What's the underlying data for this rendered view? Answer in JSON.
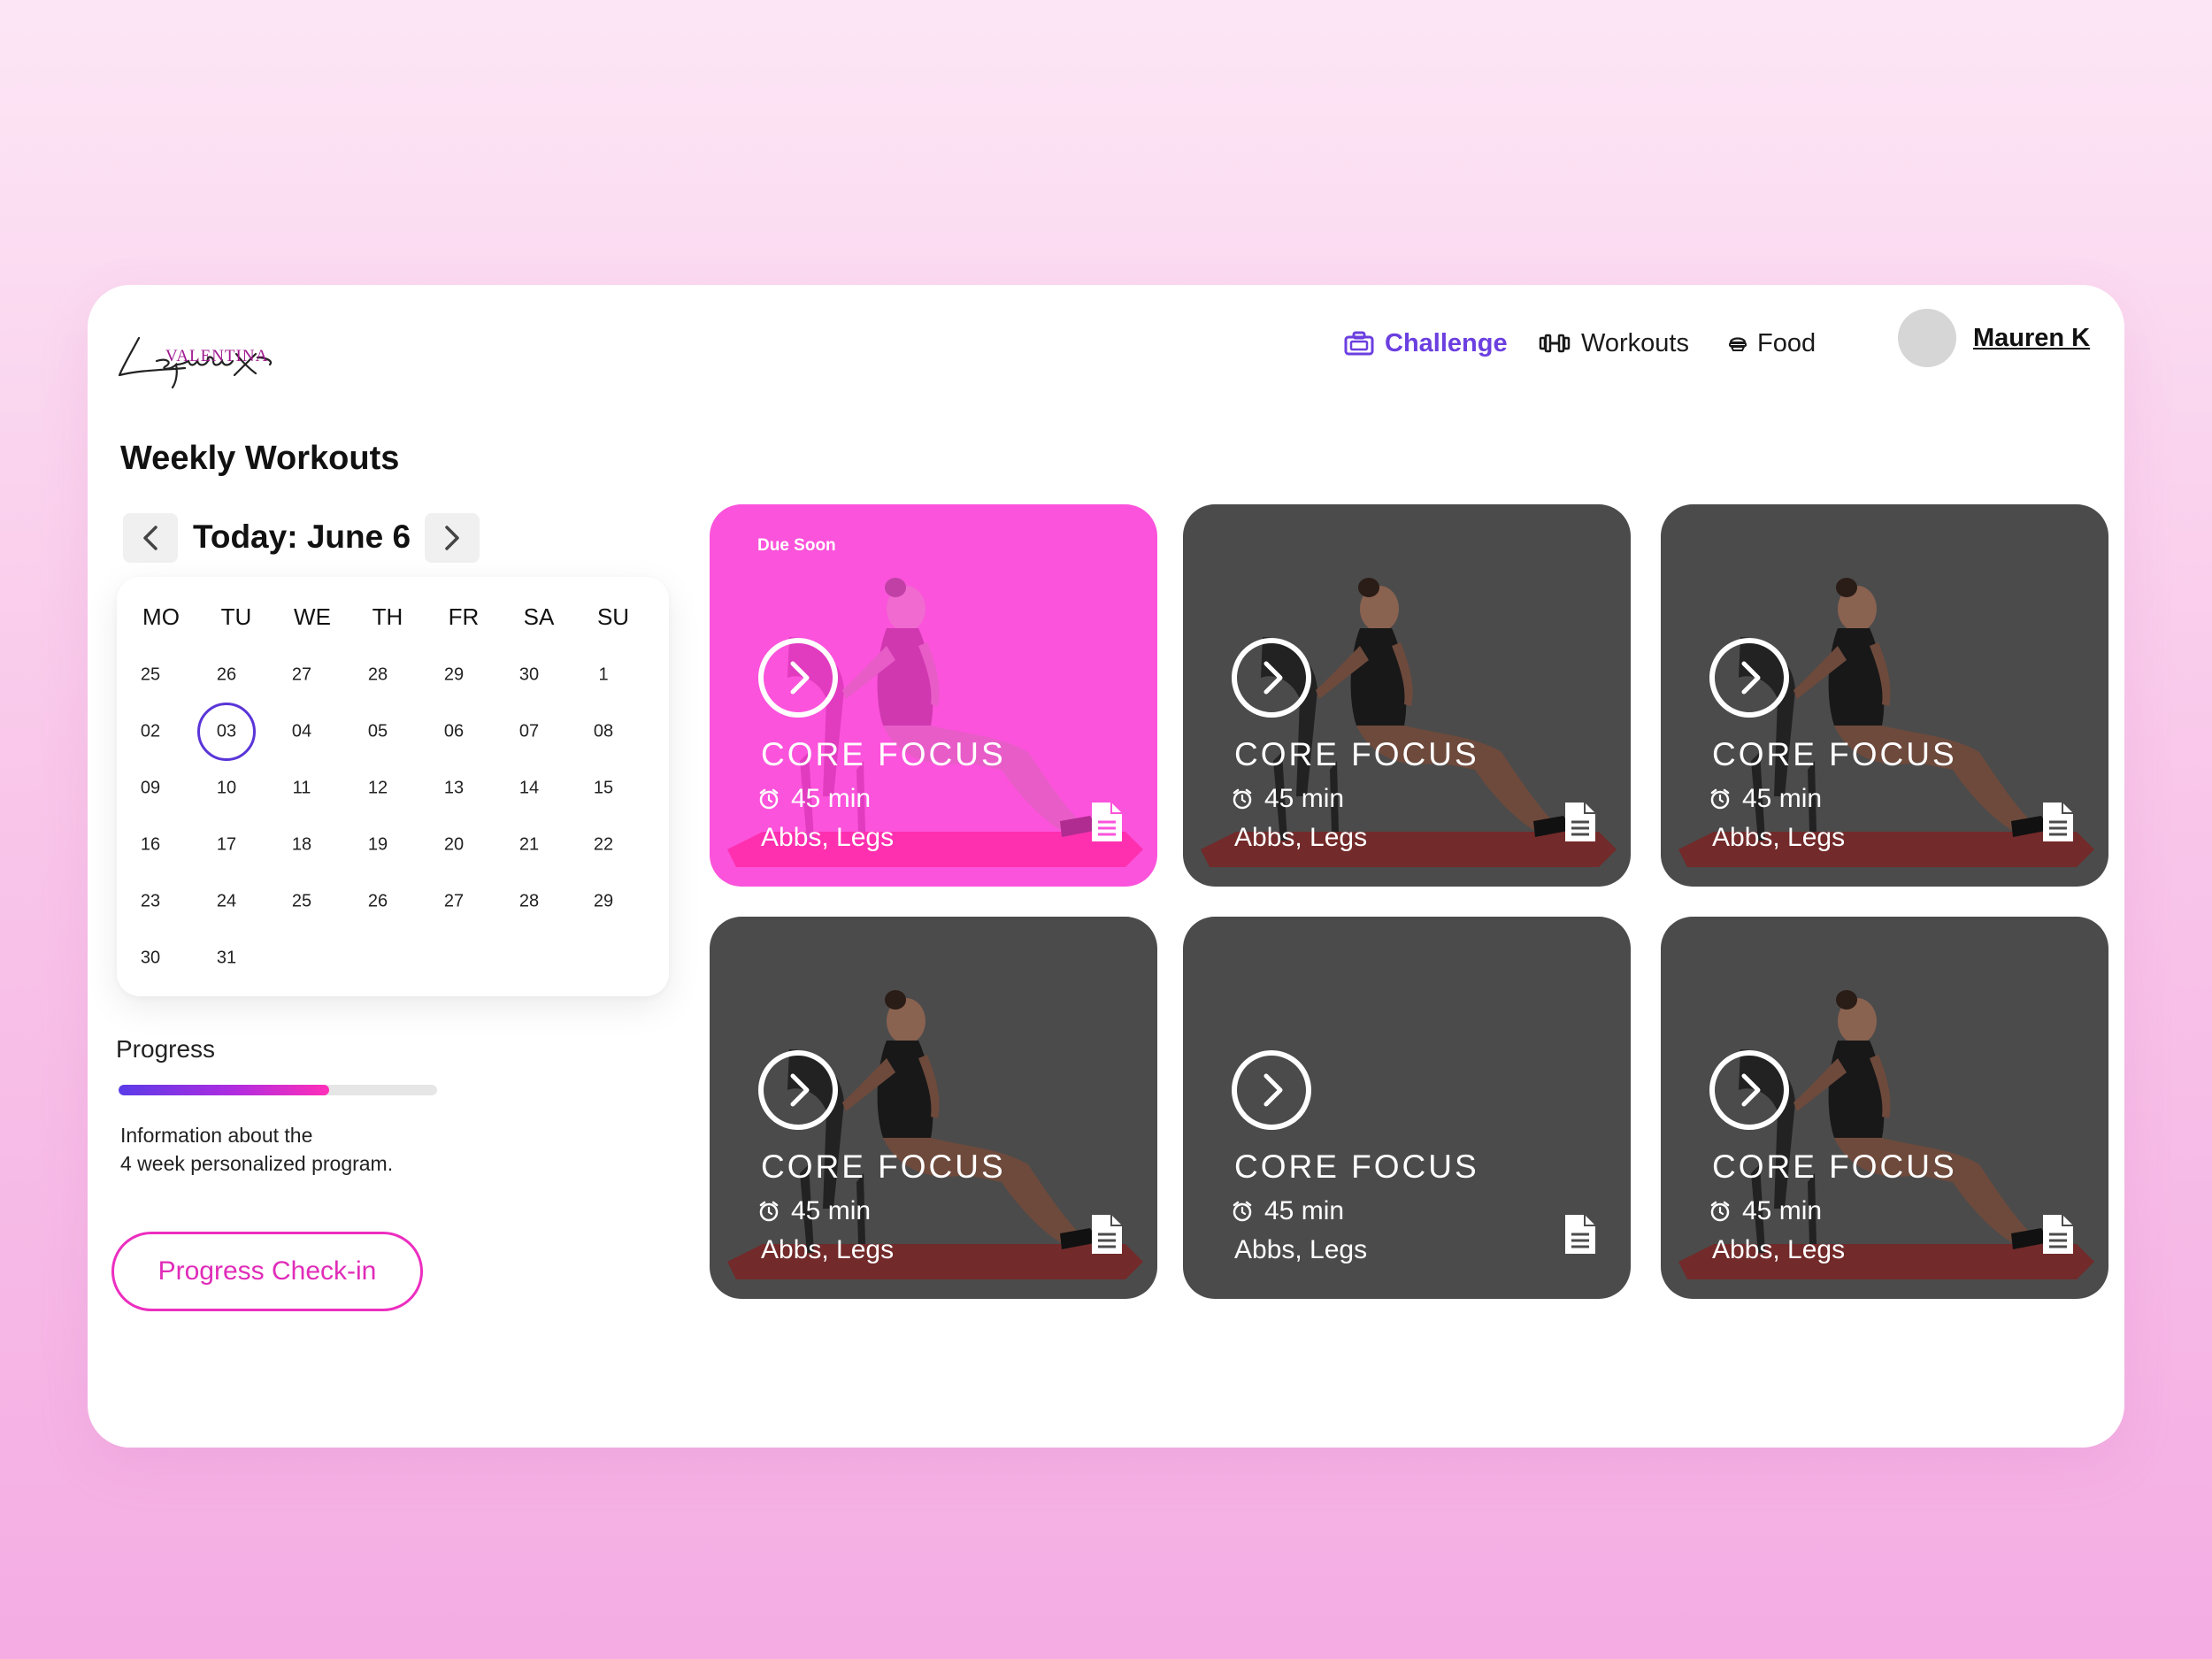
{
  "brand": {
    "logo_top": "VALENTINA",
    "logo_script": "Lequeux"
  },
  "nav": {
    "challenge": "Challenge",
    "workouts": "Workouts",
    "food": "Food",
    "user_name": "Mauren K",
    "active_color": "#6b3fe0"
  },
  "main": {
    "title": "Weekly Workouts",
    "date_label": "Today: June 6"
  },
  "calendar": {
    "headers": [
      "MO",
      "TU",
      "WE",
      "TH",
      "FR",
      "SA",
      "SU"
    ],
    "weeks": [
      [
        "25",
        "26",
        "27",
        "28",
        "29",
        "30",
        "1"
      ],
      [
        "02",
        "03",
        "04",
        "05",
        "06",
        "07",
        "08"
      ],
      [
        "09",
        "10",
        "11",
        "12",
        "13",
        "14",
        "15"
      ],
      [
        "16",
        "17",
        "18",
        "19",
        "20",
        "21",
        "22"
      ],
      [
        "23",
        "24",
        "25",
        "26",
        "27",
        "28",
        "29"
      ],
      [
        "30",
        "31",
        "",
        "",
        "",
        "",
        ""
      ]
    ],
    "selected": "03",
    "selected_color": "#5a35d8"
  },
  "progress": {
    "label": "Progress",
    "value": 0.66,
    "info": "Information about the\n4 week personalized program.",
    "checkin_label": "Progress Check-in"
  },
  "workouts": [
    {
      "badge": "Due Soon",
      "title": "CORE FOCUS",
      "duration": "45 min",
      "tags": "Abbs, Legs",
      "state": "active"
    },
    {
      "badge": "",
      "title": "CORE FOCUS",
      "duration": "45 min",
      "tags": "Abbs, Legs",
      "state": "default"
    },
    {
      "badge": "",
      "title": "CORE FOCUS",
      "duration": "45 min",
      "tags": "Abbs, Legs",
      "state": "default"
    },
    {
      "badge": "",
      "title": "CORE FOCUS",
      "duration": "45 min",
      "tags": "Abbs, Legs",
      "state": "default"
    },
    {
      "badge": "",
      "title": "CORE FOCUS",
      "duration": "45 min",
      "tags": "Abbs, Legs",
      "state": "no-image"
    },
    {
      "badge": "",
      "title": "CORE FOCUS",
      "duration": "45 min",
      "tags": "Abbs, Legs",
      "state": "default"
    }
  ],
  "colors": {
    "accent_pink": "#fb53db",
    "tile_dark": "#4b4b4b",
    "checkin_pink": "#ec2ec0"
  },
  "icons": [
    "briefcase-icon",
    "dumbbell-icon",
    "food-bowl-icon",
    "chevron-left-icon",
    "chevron-right-icon",
    "play-circle-icon",
    "alarm-clock-icon",
    "document-icon",
    "chat-icon"
  ]
}
